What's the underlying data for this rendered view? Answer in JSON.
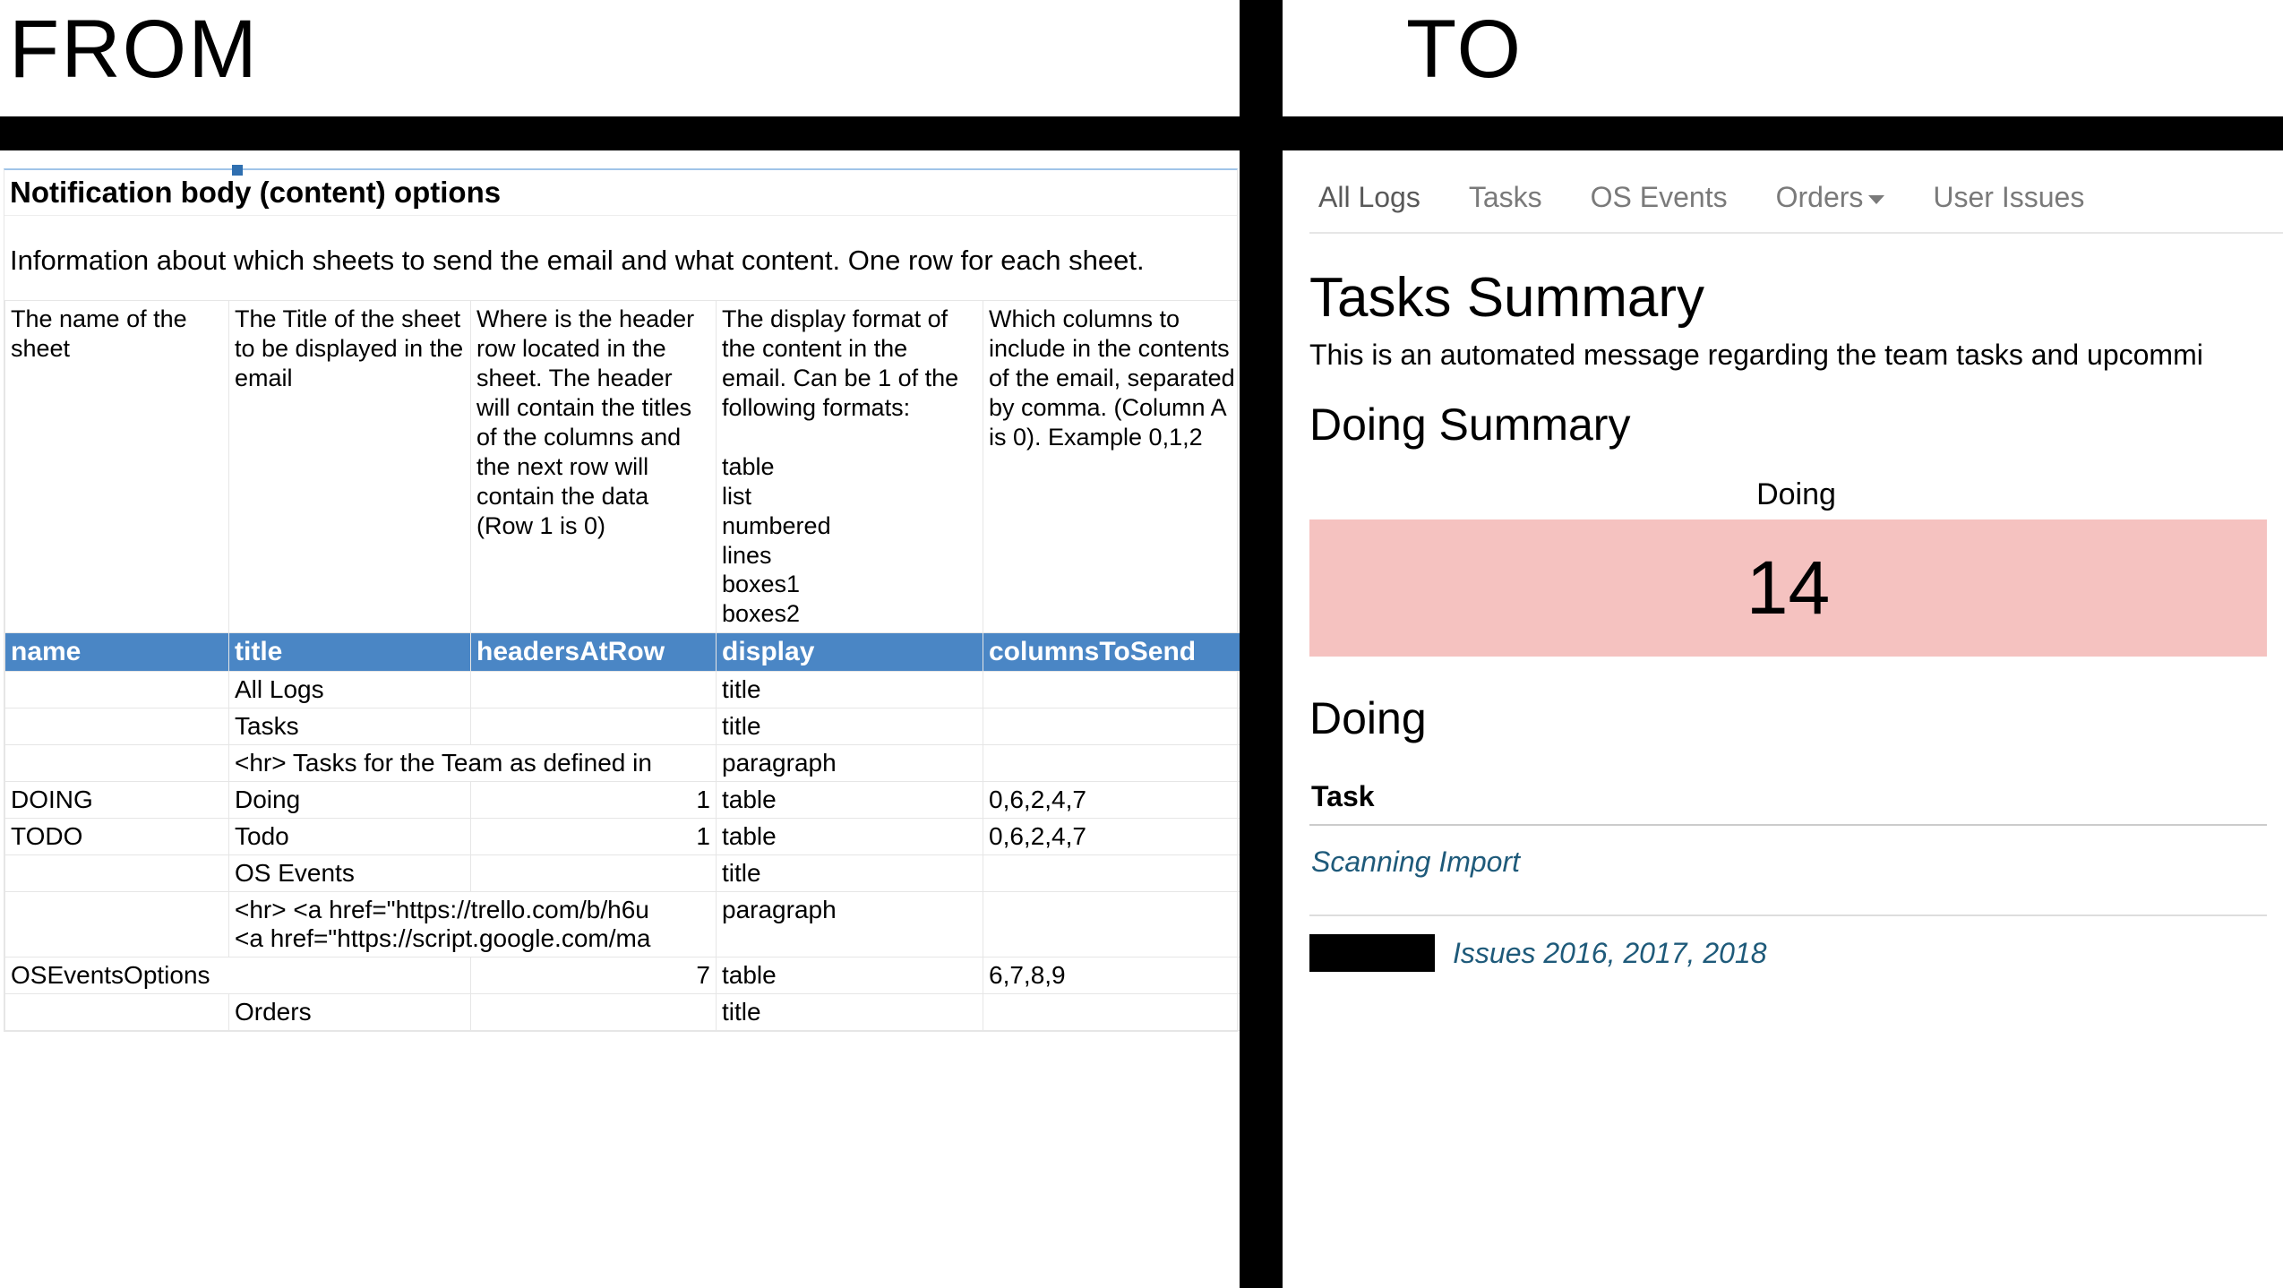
{
  "labels": {
    "from": "FROM",
    "to": "TO"
  },
  "left": {
    "title": "Notification body (content) options",
    "description": "Information about which sheets to send the email and what content. One row for each sheet.",
    "colDescriptions": [
      "The name of the sheet",
      "The Title of the sheet to be displayed in the email",
      "Where is the header row located in the sheet. The header will contain the titles of the columns and the next row will contain the data (Row 1 is 0)",
      "The display format of the content in the email. Can be 1 of the following formats:\n\ntable\nlist\nnumbered\nlines\nboxes1\nboxes2",
      "Which columns to include in the contents of the email, separated by comma. (Column A is 0). Example 0,1,2"
    ],
    "headers": [
      "name",
      "title",
      "headersAtRow",
      "display",
      "columnsToSend"
    ],
    "rows": [
      {
        "name": "",
        "title": "All Logs",
        "headersAtRow": "",
        "display": "title",
        "columnsToSend": ""
      },
      {
        "name": "",
        "title": "Tasks",
        "headersAtRow": "",
        "display": "title",
        "columnsToSend": ""
      },
      {
        "name": "",
        "title": "<hr> Tasks for the Team as defined in",
        "headersAtRow": "",
        "display": "paragraph",
        "columnsToSend": "",
        "span_title": true
      },
      {
        "name": "DOING",
        "title": "Doing",
        "headersAtRow": "1",
        "display": "table",
        "columnsToSend": "0,6,2,4,7"
      },
      {
        "name": "TODO",
        "title": "Todo",
        "headersAtRow": "1",
        "display": "table",
        "columnsToSend": "0,6,2,4,7"
      },
      {
        "name": "",
        "title": "OS Events",
        "headersAtRow": "",
        "display": "title",
        "columnsToSend": ""
      },
      {
        "name": "",
        "title": "<hr> <a href=\"https://trello.com/b/h6u\n<a href=\"https://script.google.com/ma",
        "headersAtRow": "",
        "display": "paragraph",
        "columnsToSend": "",
        "span_title": true
      },
      {
        "name": "OSEventsOptions",
        "title": "",
        "headersAtRow": "7",
        "display": "table",
        "columnsToSend": "6,7,8,9",
        "span_name": true
      },
      {
        "name": "",
        "title": "Orders",
        "headersAtRow": "",
        "display": "title",
        "columnsToSend": ""
      }
    ]
  },
  "right": {
    "tabs": [
      {
        "label": "All Logs",
        "active": true,
        "dropdown": false
      },
      {
        "label": "Tasks",
        "active": false,
        "dropdown": false
      },
      {
        "label": "OS Events",
        "active": false,
        "dropdown": false
      },
      {
        "label": "Orders",
        "active": false,
        "dropdown": true
      },
      {
        "label": "User Issues",
        "active": false,
        "dropdown": false
      }
    ],
    "h1": "Tasks Summary",
    "subtext": "This is an automated message regarding the team tasks and upcommi",
    "h2a": "Doing Summary",
    "stat_label": "Doing",
    "stat_value": "14",
    "h2b": "Doing",
    "task_header": "Task",
    "task_item": "Scanning Import",
    "footer_text": "Issues 2016, 2017, 2018"
  }
}
